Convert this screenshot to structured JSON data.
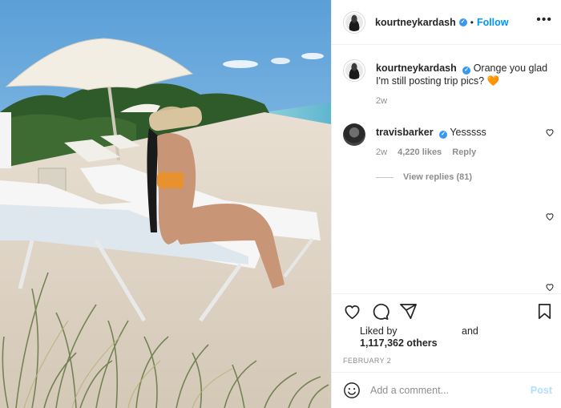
{
  "post": {
    "author": "kourtneykardash",
    "follow_label": "Follow",
    "separator": "•",
    "more_label": "•••"
  },
  "caption": {
    "username": "kourtneykardash",
    "text": "Orange you glad I'm still posting trip pics? 🧡",
    "time": "2w"
  },
  "comments": [
    {
      "username": "travisbarker",
      "text": "Yesssss",
      "time": "2w",
      "likes": "4,220 likes",
      "reply_label": "Reply",
      "view_replies": "View replies (81)"
    }
  ],
  "likes": {
    "liked_by": "Liked by",
    "and": "and",
    "count": "1,117,362 others"
  },
  "date": "FEBRUARY 2",
  "comment_box": {
    "placeholder": "Add a comment...",
    "post_label": "Post"
  },
  "colors": {
    "accent": "#0095f6",
    "verified": "#3897f0",
    "post_disabled": "#b2dffc"
  },
  "icons": [
    "verified-badge-icon",
    "heart-icon",
    "comment-icon",
    "share-icon",
    "bookmark-icon",
    "emoji-icon"
  ]
}
